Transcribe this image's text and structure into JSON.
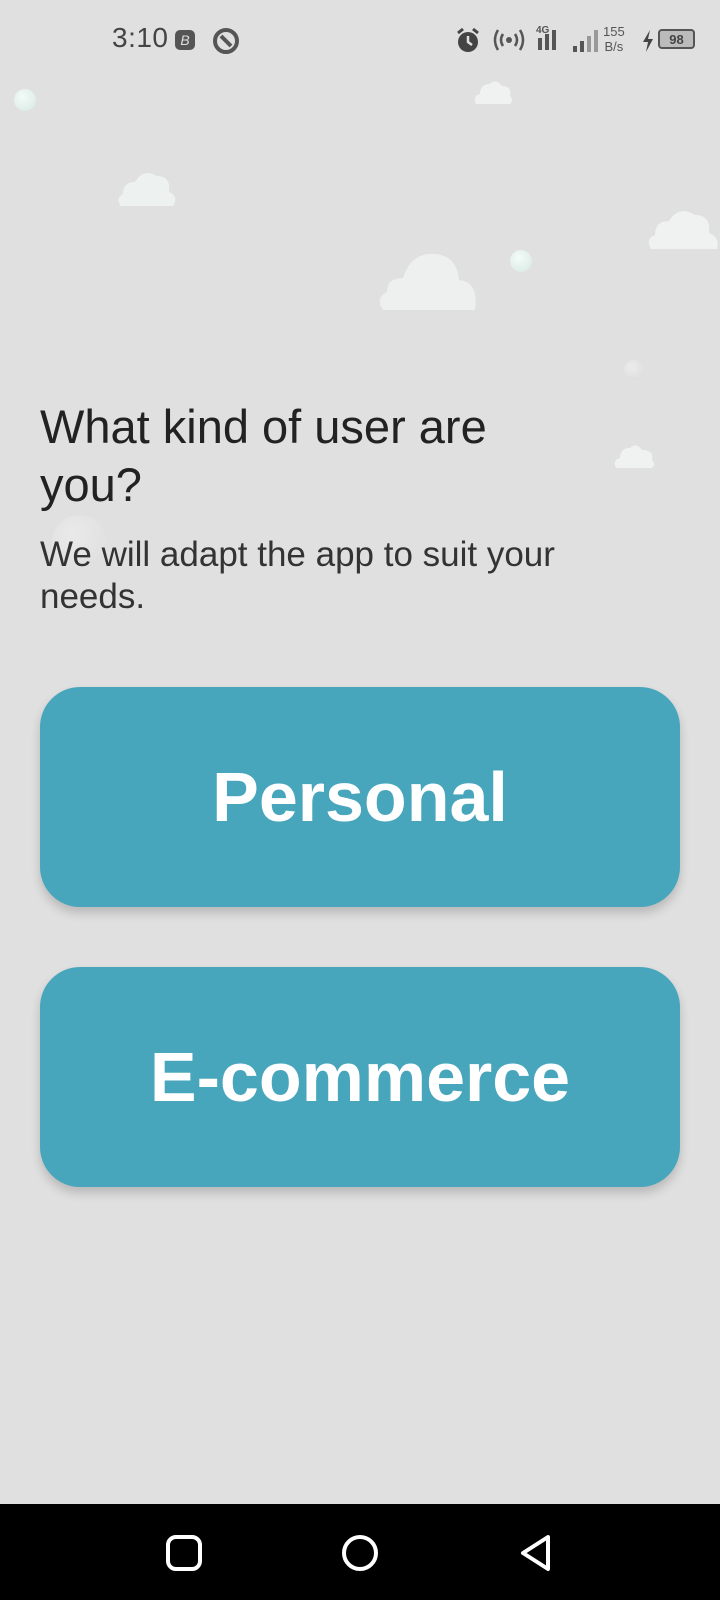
{
  "status_bar": {
    "time": "3:10",
    "network_speed_value": "155",
    "network_speed_unit": "B/s",
    "network_type": "4G",
    "battery_level": "98",
    "icons": [
      "b-app-icon",
      "vpn-icon",
      "alarm-icon",
      "hotspot-icon",
      "signal-icon",
      "signal-icon",
      "charging-icon",
      "battery-icon"
    ]
  },
  "screen": {
    "title": "What kind of user are you?",
    "subtitle": "We will adapt the app to suit your needs."
  },
  "options": {
    "personal_label": "Personal",
    "ecommerce_label": "E-commerce"
  },
  "colors": {
    "background": "#e0e0e0",
    "button": "#47a5bc",
    "button_text": "#ffffff"
  },
  "nav_bar": {
    "icons": [
      "recents-icon",
      "home-icon",
      "back-icon"
    ]
  }
}
